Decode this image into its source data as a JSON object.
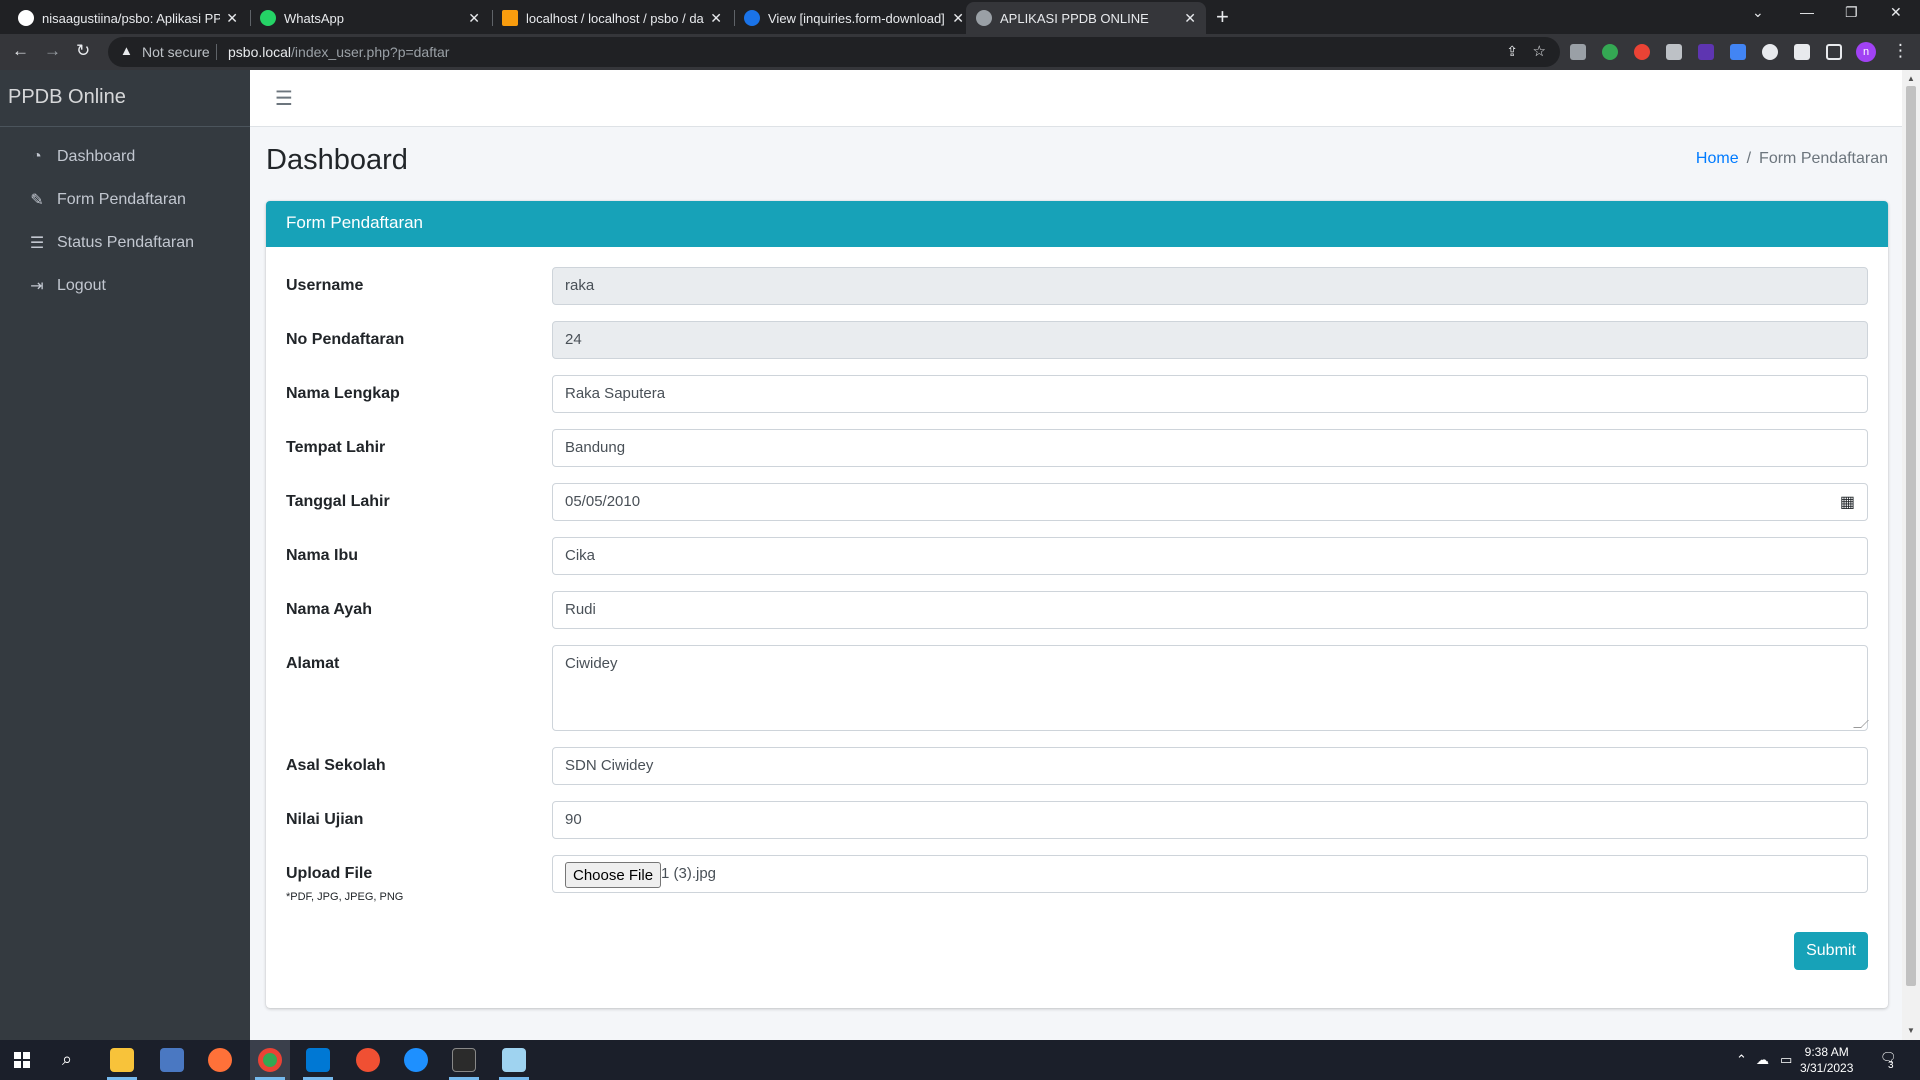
{
  "browser": {
    "tabs": [
      {
        "title": "nisaagustiina/psbo: Aplikasi PPDB",
        "icon": "github-icon"
      },
      {
        "title": "WhatsApp",
        "icon": "whatsapp-icon"
      },
      {
        "title": "localhost / localhost / psbo / daftar",
        "icon": "phpmyadmin-icon"
      },
      {
        "title": "View [inquiries.form-download]",
        "icon": "edit-icon"
      },
      {
        "title": "APLIKASI PPDB ONLINE",
        "icon": "globe-icon"
      }
    ],
    "security_label": "Not secure",
    "url_host": "psbo.local",
    "url_path": "/index_user.php?p=daftar",
    "profile_initial": "n"
  },
  "sidebar": {
    "brand": "PPDB Online",
    "items": [
      {
        "label": "Dashboard",
        "icon": "dashboard-icon"
      },
      {
        "label": "Form Pendaftaran",
        "icon": "edit-icon"
      },
      {
        "label": "Status Pendaftaran",
        "icon": "list-icon"
      },
      {
        "label": "Logout",
        "icon": "logout-icon"
      }
    ]
  },
  "header": {
    "page_title": "Dashboard",
    "breadcrumb_home": "Home",
    "breadcrumb_sep": "/",
    "breadcrumb_current": "Form Pendaftaran"
  },
  "form": {
    "title": "Form Pendaftaran",
    "fields": {
      "username": {
        "label": "Username",
        "value": "raka"
      },
      "no_pendaftaran": {
        "label": "No Pendaftaran",
        "value": "24"
      },
      "nama_lengkap": {
        "label": "Nama Lengkap",
        "value": "Raka Saputera"
      },
      "tempat_lahir": {
        "label": "Tempat Lahir",
        "value": "Bandung"
      },
      "tanggal_lahir": {
        "label": "Tanggal Lahir",
        "value": "05/05/2010"
      },
      "nama_ibu": {
        "label": "Nama Ibu",
        "value": "Cika"
      },
      "nama_ayah": {
        "label": "Nama Ayah",
        "value": "Rudi"
      },
      "alamat": {
        "label": "Alamat",
        "value": "Ciwidey"
      },
      "asal_sekolah": {
        "label": "Asal Sekolah",
        "value": "SDN Ciwidey"
      },
      "nilai_ujian": {
        "label": "Nilai Ujian",
        "value": "90"
      },
      "upload_file": {
        "label": "Upload File",
        "hint": "*PDF, JPG, JPEG, PNG",
        "button": "Choose File",
        "value": "1 (3).jpg"
      }
    },
    "submit_label": "Submit"
  },
  "taskbar": {
    "time": "9:38 AM",
    "date": "3/31/2023",
    "notifications": "3"
  },
  "colors": {
    "accent": "#17a2b8",
    "sidebar_bg": "#343a40",
    "link": "#007bff"
  }
}
